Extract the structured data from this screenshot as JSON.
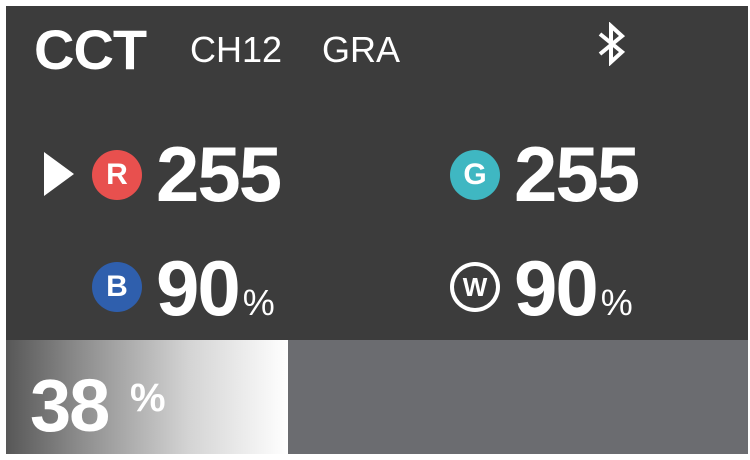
{
  "header": {
    "mode": "CCT",
    "channel": "CH12",
    "effect": "GRA",
    "bluetooth_icon": "bluetooth-icon"
  },
  "params": {
    "r": {
      "badge": "R",
      "value": "255",
      "color": "#e8504e"
    },
    "g": {
      "badge": "G",
      "value": "255",
      "color": "#3fb7c2"
    },
    "b": {
      "badge": "B",
      "value": "90",
      "unit": "%",
      "color": "#2f5fad"
    },
    "w": {
      "badge": "W",
      "value": "90",
      "unit": "%",
      "color": "#ffffff"
    }
  },
  "brightness": {
    "value": "38",
    "unit": "%",
    "level_fraction": 0.38
  }
}
